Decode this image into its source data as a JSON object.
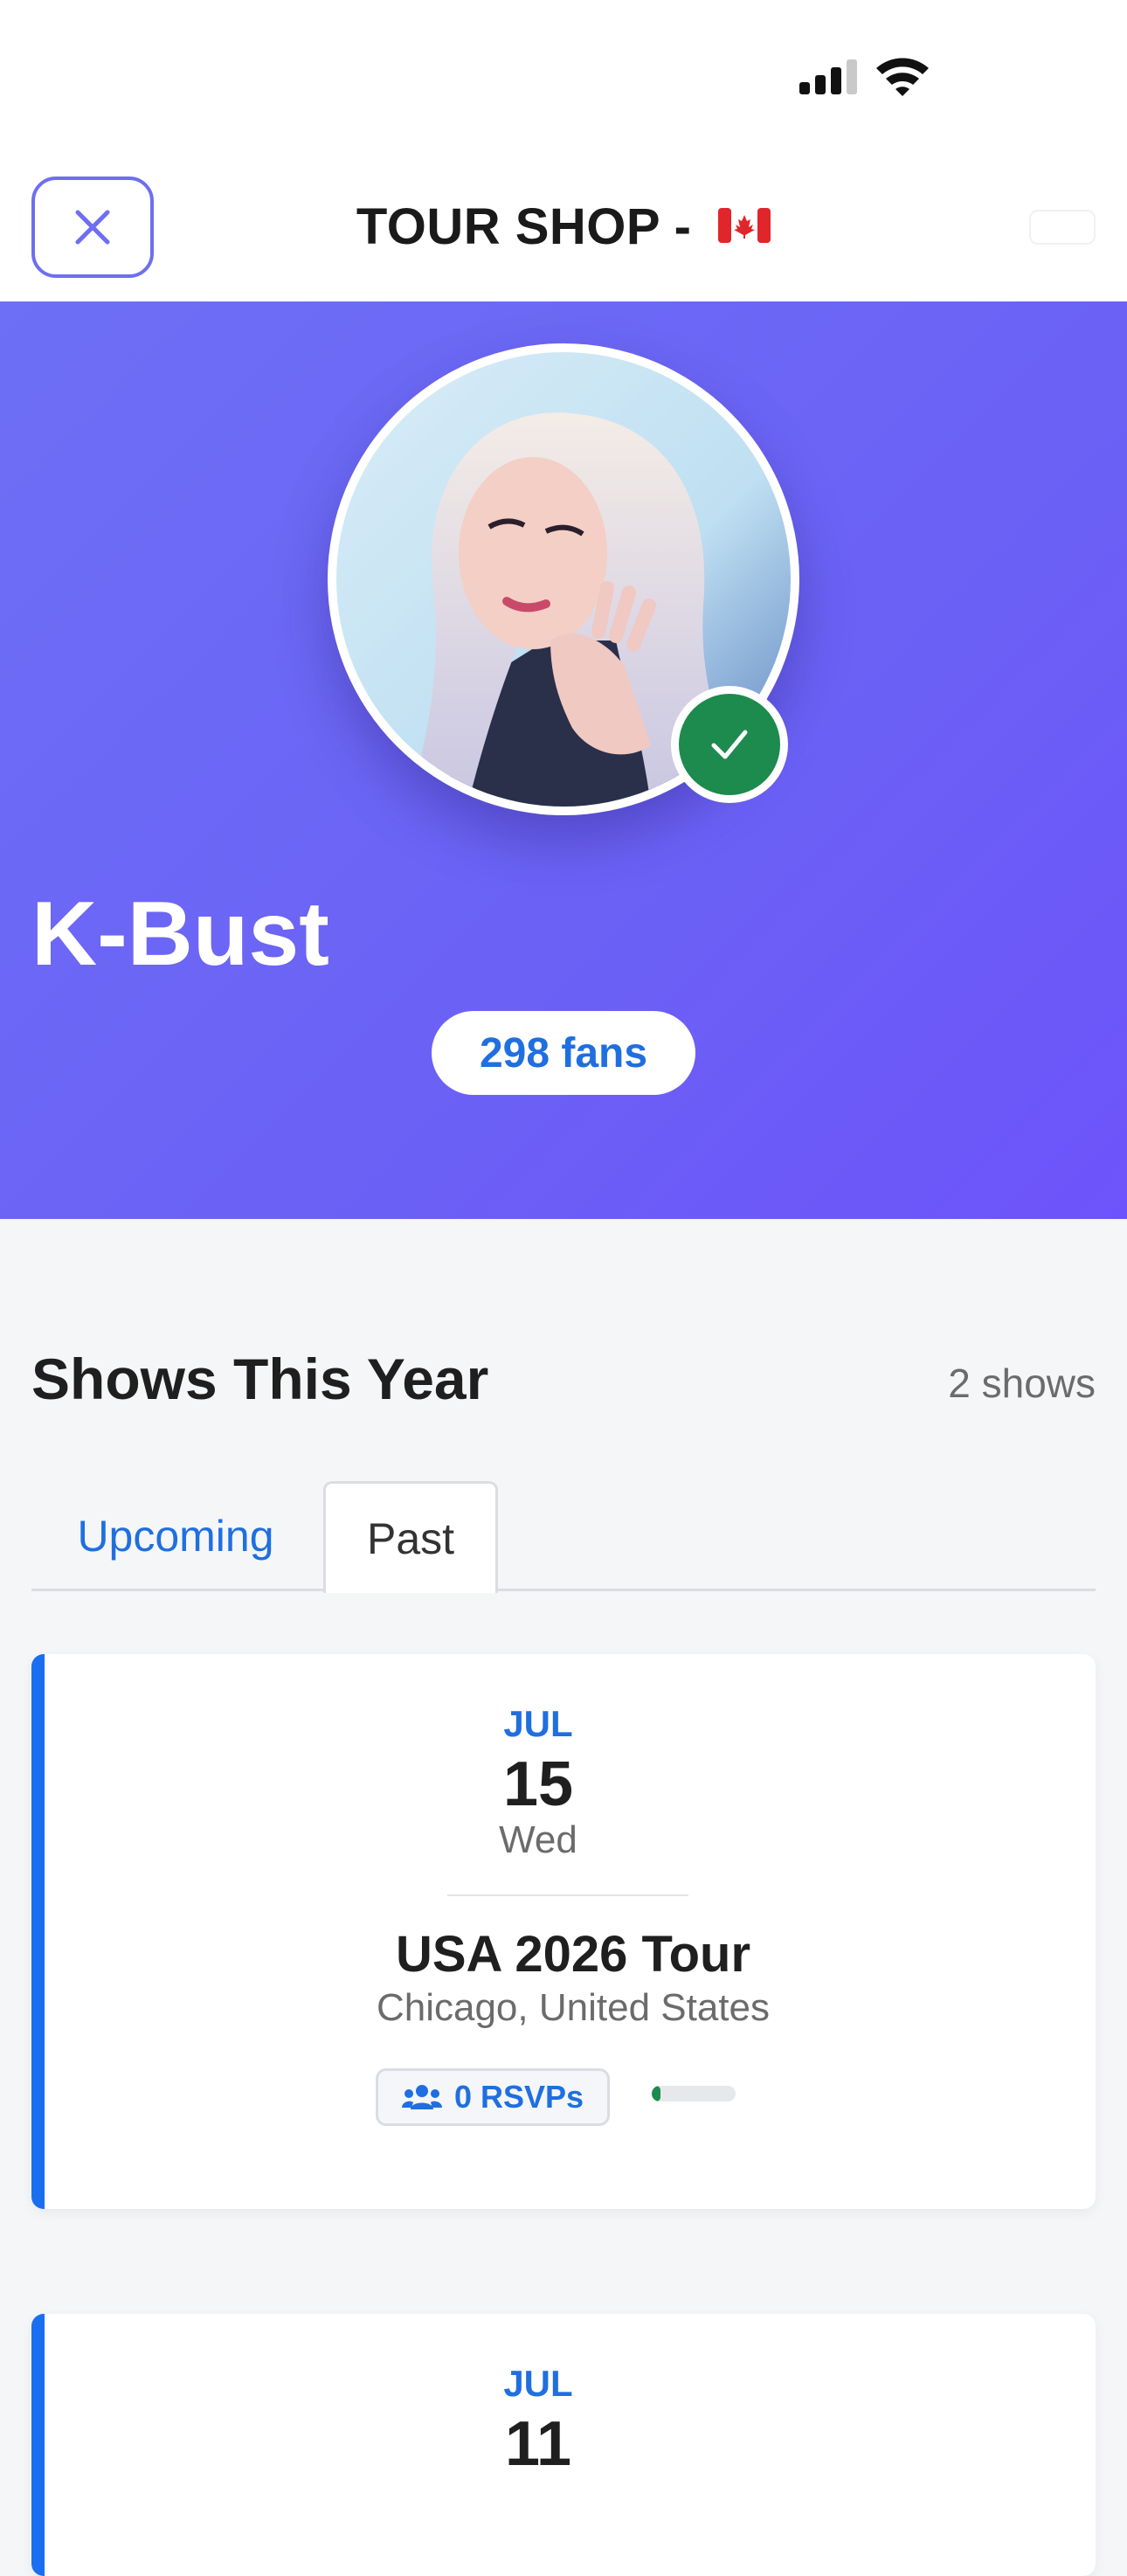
{
  "header": {
    "title": "TOUR SHOP -",
    "flag_icon": "canada-flag-icon"
  },
  "artist": {
    "name": "K-Bust",
    "fans_label": "298 fans",
    "verified": true
  },
  "shows_section": {
    "title": "Shows This Year",
    "count_label": "2 shows",
    "tabs": [
      {
        "label": "Upcoming",
        "active": false
      },
      {
        "label": "Past",
        "active": true
      }
    ]
  },
  "shows": [
    {
      "month": "JUL",
      "day": "15",
      "weekday": "Wed",
      "tour": "USA 2026 Tour",
      "location": "Chicago, United States",
      "rsvp_label": "0 RSVPs",
      "rsvp_progress": 0.1
    },
    {
      "month": "JUL",
      "day": "11"
    }
  ],
  "colors": {
    "accent": "#1f6fe0",
    "hero_gradient_start": "#6d6ff6",
    "hero_gradient_end": "#6d53fb",
    "verified_green": "#1d8a4e",
    "card_border": "#1a6ef0"
  }
}
